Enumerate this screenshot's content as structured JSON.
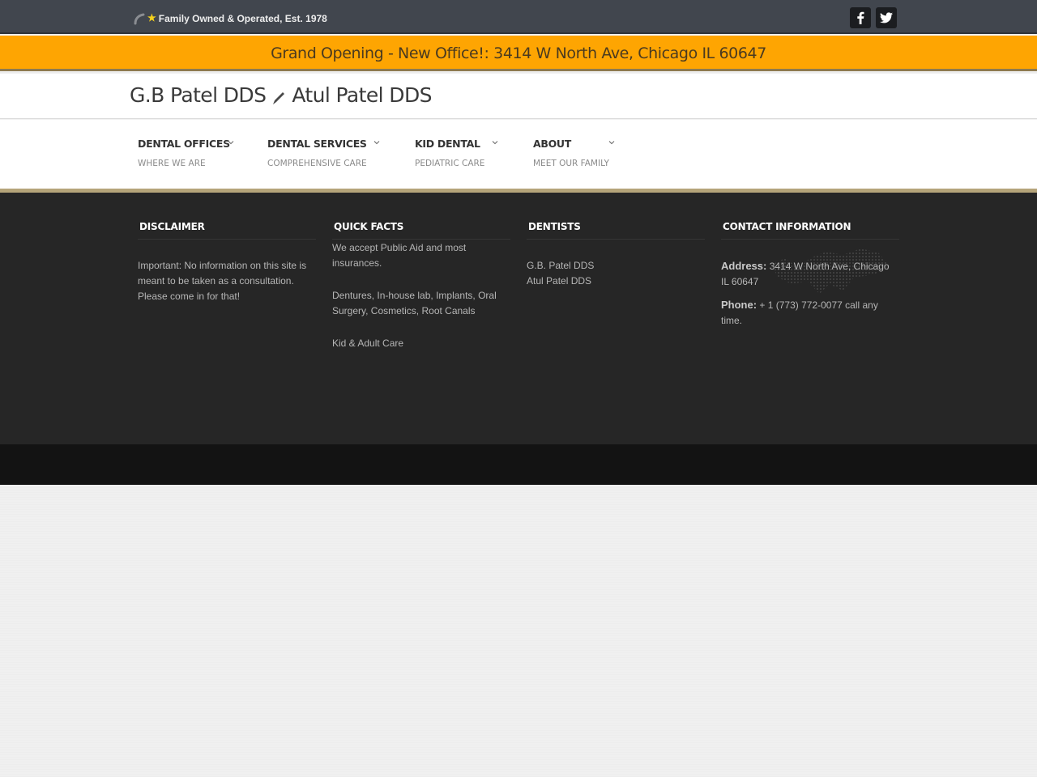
{
  "topbar": {
    "tagline": "Family Owned & Operated, Est. 1978",
    "social": [
      "facebook-icon",
      "twitter-icon"
    ]
  },
  "announcement": {
    "text": "Grand Opening - New Office!: 3414 W North Ave, Chicago IL 60647"
  },
  "header": {
    "title_left": "G.B Patel DDS",
    "title_right": "Atul Patel DDS"
  },
  "nav": {
    "items": [
      {
        "label": "DENTAL OFFICES",
        "sub": "WHERE WE ARE"
      },
      {
        "label": "DENTAL SERVICES",
        "sub": "COMPREHENSIVE CARE"
      },
      {
        "label": "KID DENTAL",
        "sub": "PEDIATRIC CARE"
      },
      {
        "label": "ABOUT",
        "sub": "MEET OUR FAMILY"
      }
    ]
  },
  "footer": {
    "disclaimer": {
      "title": "DISCLAIMER",
      "text": "Important: No information on this site is meant to be taken as a consultation. Please come in for that!"
    },
    "quick_facts": {
      "title": "QUICK FACTS",
      "items": [
        "We accept Public Aid and most insurances.",
        "Dentures, In-house lab, Implants, Oral Surgery, Cosmetics, Root Canals",
        "Kid & Adult Care"
      ]
    },
    "dentists": {
      "title": "DENTISTS",
      "items": [
        "G.B. Patel DDS",
        "Atul Patel DDS"
      ]
    },
    "contact": {
      "title": "CONTACT INFORMATION",
      "address_label": "Address:",
      "address": "3414 W North Ave, Chicago IL 60647",
      "phone_label": "Phone:",
      "phone": "+ 1 (773) 772-0077 call any time."
    }
  },
  "colors": {
    "topbar": "#41464e",
    "announcement": "#fea502",
    "footer": "#262626",
    "footer_bottom": "#131313",
    "accent_rule": "#b5a47a"
  }
}
